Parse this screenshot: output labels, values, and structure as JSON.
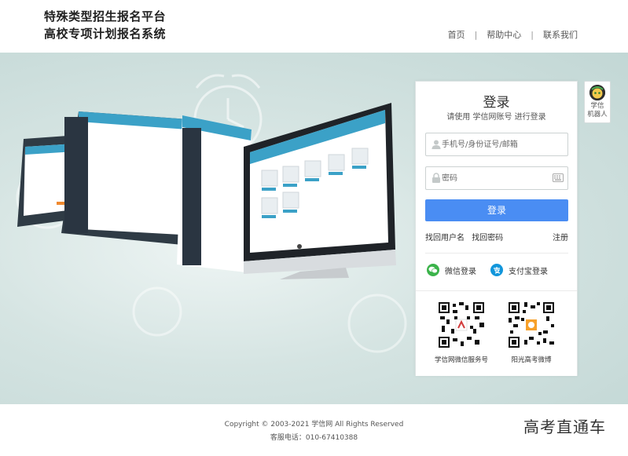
{
  "header": {
    "title_line1": "特殊类型招生报名平台",
    "title_line2": "高校专项计划报名系统",
    "nav": [
      "首页",
      "帮助中心",
      "联系我们"
    ]
  },
  "login": {
    "title": "登录",
    "subtitle": "请使用 学信网账号 进行登录",
    "username_placeholder": "手机号/身份证号/邮箱",
    "password_placeholder": "密码",
    "login_button": "登录",
    "find_username": "找回用户名",
    "find_password": "找回密码",
    "register": "注册",
    "wechat_login": "微信登录",
    "alipay_login": "支付宝登录",
    "qr_left_label": "学信网微信服务号",
    "qr_right_label": "阳光高考微博"
  },
  "robot": {
    "line1": "学信",
    "line2": "机器人"
  },
  "footer": {
    "copyright": "Copyright © 2003-2021 学信网 All Rights Reserved",
    "phone": "客服电话：010-67410388"
  },
  "watermark": "高考直通车",
  "colors": {
    "primary_button": "#4a8df3",
    "banner_bg": "#c9dcda",
    "wechat": "#3bb34a",
    "alipay": "#1296db"
  }
}
